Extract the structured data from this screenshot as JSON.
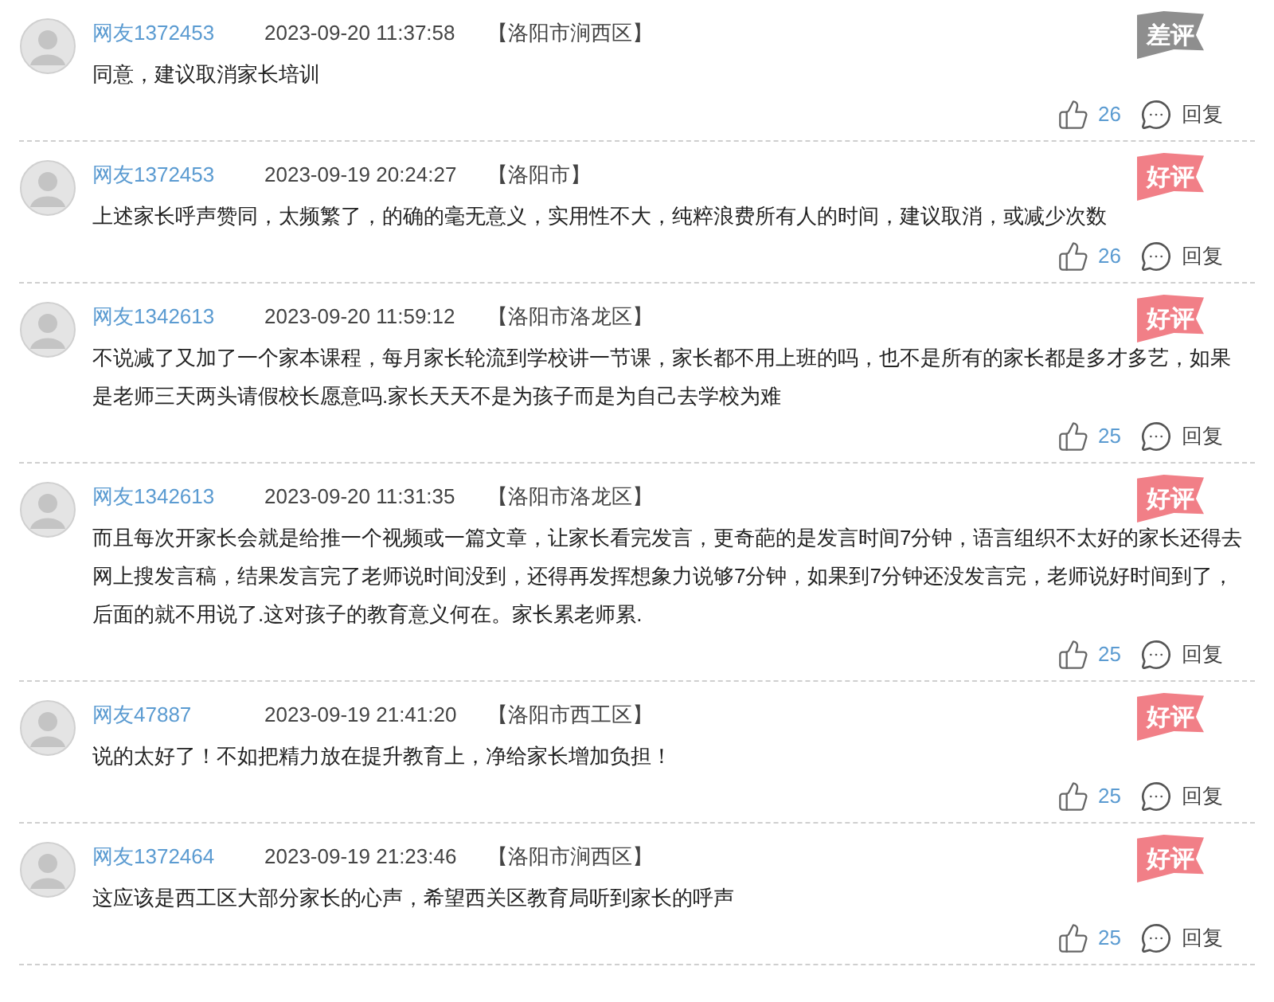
{
  "comments": [
    {
      "user": "网友1372453",
      "time": "2023-09-20 11:37:58",
      "location": "【洛阳市涧西区】",
      "rating": {
        "kind": "bad",
        "label": "差评"
      },
      "text": "同意，建议取消家长培训",
      "likes": "26",
      "reply": "回复"
    },
    {
      "user": "网友1372453",
      "time": "2023-09-19 20:24:27",
      "location": "【洛阳市】",
      "rating": {
        "kind": "good",
        "label": "好评"
      },
      "text": "上述家长呼声赞同，太频繁了，的确的毫无意义，实用性不大，纯粹浪费所有人的时间，建议取消，或减少次数",
      "likes": "26",
      "reply": "回复"
    },
    {
      "user": "网友1342613",
      "time": "2023-09-20 11:59:12",
      "location": "【洛阳市洛龙区】",
      "rating": {
        "kind": "good",
        "label": "好评"
      },
      "text": "不说减了又加了一个家本课程，每月家长轮流到学校讲一节课，家长都不用上班的吗，也不是所有的家长都是多才多艺，如果是老师三天两头请假校长愿意吗.家长天天不是为孩子而是为自己去学校为难",
      "likes": "25",
      "reply": "回复"
    },
    {
      "user": "网友1342613",
      "time": "2023-09-20 11:31:35",
      "location": "【洛阳市洛龙区】",
      "rating": {
        "kind": "good",
        "label": "好评"
      },
      "text": "而且每次开家长会就是给推一个视频或一篇文章，让家长看完发言，更奇葩的是发言时间7分钟，语言组织不太好的家长还得去网上搜发言稿，结果发言完了老师说时间没到，还得再发挥想象力说够7分钟，如果到7分钟还没发言完，老师说好时间到了，后面的就不用说了.这对孩子的教育意义何在。家长累老师累.",
      "likes": "25",
      "reply": "回复"
    },
    {
      "user": "网友47887",
      "time": "2023-09-19 21:41:20",
      "location": "【洛阳市西工区】",
      "rating": {
        "kind": "good",
        "label": "好评"
      },
      "text": "说的太好了！不如把精力放在提升教育上，净给家长增加负担！",
      "likes": "25",
      "reply": "回复"
    },
    {
      "user": "网友1372464",
      "time": "2023-09-19 21:23:46",
      "location": "【洛阳市涧西区】",
      "rating": {
        "kind": "good",
        "label": "好评"
      },
      "text": "这应该是西工区大部分家长的心声，希望西关区教育局听到家长的呼声",
      "likes": "25",
      "reply": "回复"
    }
  ]
}
